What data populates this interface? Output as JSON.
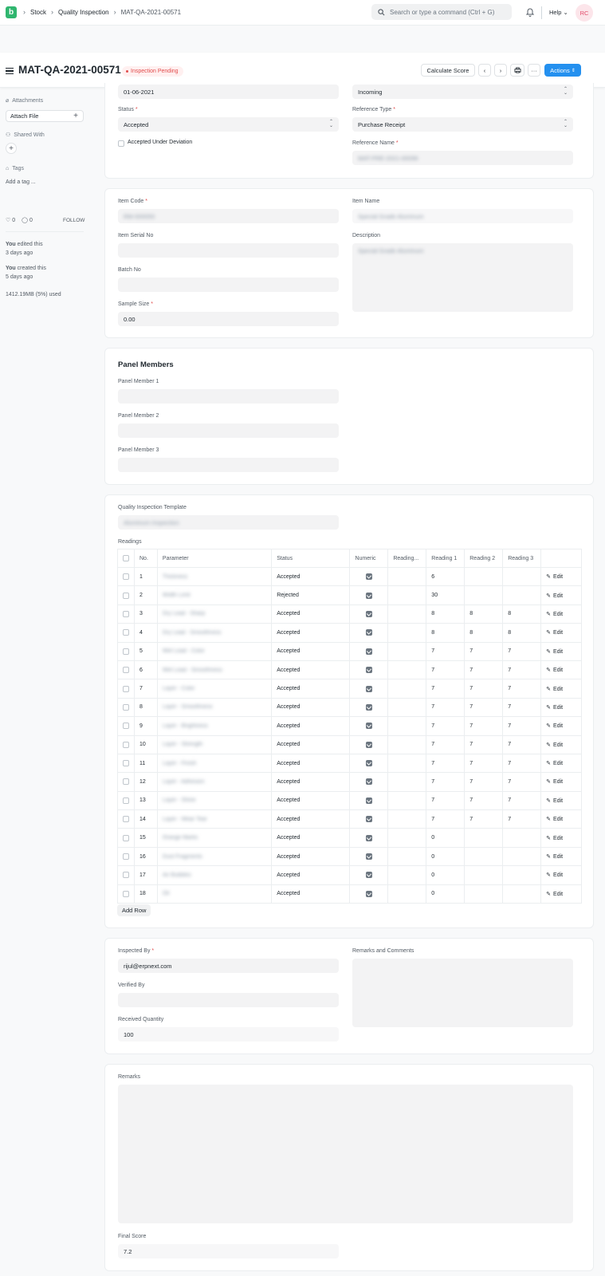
{
  "nav": {
    "logo_letter": "b",
    "breadcrumbs": [
      "Stock",
      "Quality Inspection",
      "MAT-QA-2021-00571"
    ],
    "search_placeholder": "Search or type a command (Ctrl + G)",
    "help_label": "Help",
    "avatar_initials": "RC"
  },
  "header": {
    "title": "MAT-QA-2021-00571",
    "status": "Inspection Pending",
    "calculate_score_label": "Calculate Score",
    "more_label": "···",
    "actions_label": "Actions"
  },
  "sidebar": {
    "attachments_label": "Attachments",
    "attach_file_label": "Attach File",
    "shared_with_label": "Shared With",
    "tags_label": "Tags",
    "add_tag_label": "Add a tag ...",
    "likes_count": "0",
    "comments_count": "0",
    "follow_label": "FOLLOW",
    "activity": [
      {
        "user": "You",
        "action": "edited this",
        "time": "3 days ago"
      },
      {
        "user": "You",
        "action": "created this",
        "time": "5 days ago"
      }
    ],
    "storage_used": "1412.19MB (5%) used"
  },
  "inspection": {
    "report_date": "01-06-2021",
    "inspection_type": "Incoming",
    "status_label": "Status",
    "status_value": "Accepted",
    "reference_type_label": "Reference Type",
    "reference_type_value": "Purchase Receipt",
    "accepted_deviation_label": "Accepted Under Deviation",
    "reference_name_label": "Reference Name",
    "reference_name_value": "MAT-PRE-2021-00099"
  },
  "item": {
    "item_code_label": "Item Code",
    "item_code_value": "RM-000050",
    "item_name_label": "Item Name",
    "item_name_value": "Special Grade Aluminum",
    "serial_no_label": "Item Serial No",
    "description_label": "Description",
    "description_value": "Special Grade Aluminum",
    "batch_no_label": "Batch No",
    "sample_size_label": "Sample Size",
    "sample_size_value": "0.00"
  },
  "panel": {
    "title": "Panel Members",
    "members": [
      "Panel Member 1",
      "Panel Member 2",
      "Panel Member 3"
    ]
  },
  "readings": {
    "template_label": "Quality Inspection Template",
    "template_value": "Aluminum Inspection",
    "readings_label": "Readings",
    "columns": [
      "No.",
      "Parameter",
      "Status",
      "Numeric",
      "Reading...",
      "Reading 1",
      "Reading 2",
      "Reading 3"
    ],
    "edit_label": "Edit",
    "add_row_label": "Add Row",
    "rows": [
      {
        "no": "1",
        "parameter": "Thickness",
        "status": "Accepted",
        "r1": "6",
        "r2": "",
        "r3": ""
      },
      {
        "no": "2",
        "parameter": "Width Limit",
        "status": "Rejected",
        "r1": "30",
        "r2": "",
        "r3": ""
      },
      {
        "no": "3",
        "parameter": "Dry Lead - Sharp",
        "status": "Accepted",
        "r1": "8",
        "r2": "8",
        "r3": "8"
      },
      {
        "no": "4",
        "parameter": "Dry Lead - Smoothness",
        "status": "Accepted",
        "r1": "8",
        "r2": "8",
        "r3": "8"
      },
      {
        "no": "5",
        "parameter": "Wet Lead - Color",
        "status": "Accepted",
        "r1": "7",
        "r2": "7",
        "r3": "7"
      },
      {
        "no": "6",
        "parameter": "Wet Lead - Smoothness",
        "status": "Accepted",
        "r1": "7",
        "r2": "7",
        "r3": "7"
      },
      {
        "no": "7",
        "parameter": "Layer - Color",
        "status": "Accepted",
        "r1": "7",
        "r2": "7",
        "r3": "7"
      },
      {
        "no": "8",
        "parameter": "Layer - Smoothness",
        "status": "Accepted",
        "r1": "7",
        "r2": "7",
        "r3": "7"
      },
      {
        "no": "9",
        "parameter": "Layer - Brightness",
        "status": "Accepted",
        "r1": "7",
        "r2": "7",
        "r3": "7"
      },
      {
        "no": "10",
        "parameter": "Layer - Strength",
        "status": "Accepted",
        "r1": "7",
        "r2": "7",
        "r3": "7"
      },
      {
        "no": "11",
        "parameter": "Layer - Finish",
        "status": "Accepted",
        "r1": "7",
        "r2": "7",
        "r3": "7"
      },
      {
        "no": "12",
        "parameter": "Layer - Adhesion",
        "status": "Accepted",
        "r1": "7",
        "r2": "7",
        "r3": "7"
      },
      {
        "no": "13",
        "parameter": "Layer - Shine",
        "status": "Accepted",
        "r1": "7",
        "r2": "7",
        "r3": "7"
      },
      {
        "no": "14",
        "parameter": "Layer - Wear Tear",
        "status": "Accepted",
        "r1": "7",
        "r2": "7",
        "r3": "7"
      },
      {
        "no": "15",
        "parameter": "Orange Marks",
        "status": "Accepted",
        "r1": "0",
        "r2": "",
        "r3": ""
      },
      {
        "no": "16",
        "parameter": "Dust Fragments",
        "status": "Accepted",
        "r1": "0",
        "r2": "",
        "r3": ""
      },
      {
        "no": "17",
        "parameter": "Air Bubbles",
        "status": "Accepted",
        "r1": "0",
        "r2": "",
        "r3": ""
      },
      {
        "no": "18",
        "parameter": "Oil",
        "status": "Accepted",
        "r1": "0",
        "r2": "",
        "r3": ""
      }
    ]
  },
  "inspector": {
    "inspected_by_label": "Inspected By",
    "inspected_by_value": "rijul@erpnext.com",
    "remarks_comments_label": "Remarks and Comments",
    "verified_by_label": "Verified By",
    "received_qty_label": "Received Quantity",
    "received_qty_value": "100"
  },
  "final": {
    "remarks_label": "Remarks",
    "final_score_label": "Final Score",
    "final_score_value": "7.2"
  },
  "colors": {
    "primary": "#2490ef",
    "brand": "#30b66f",
    "pending_red": "#e24c4c"
  }
}
